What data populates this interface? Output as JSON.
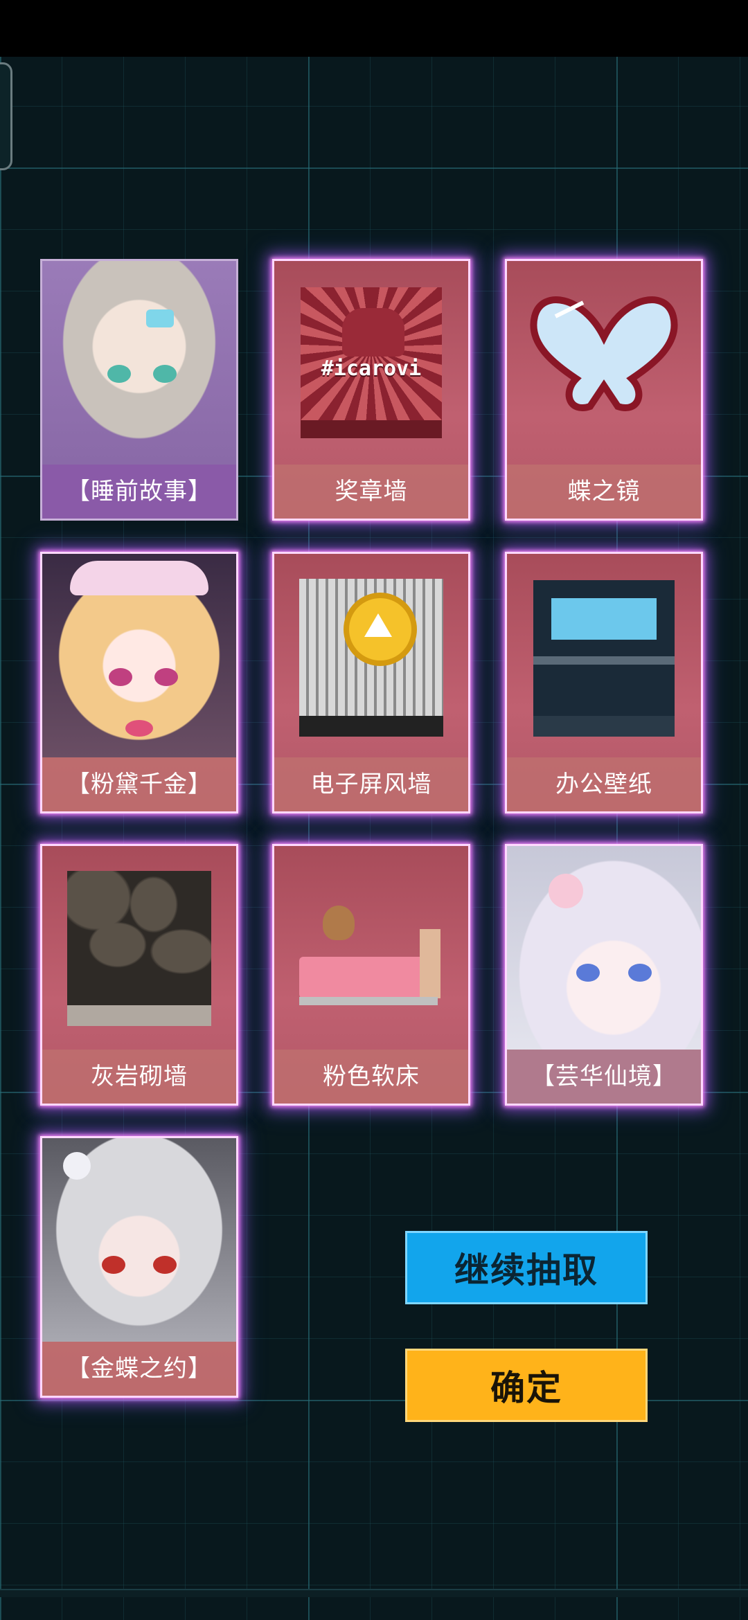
{
  "cards": [
    {
      "label": "【睡前故事】",
      "icon": "character-portrait"
    },
    {
      "label": "奖章墙",
      "icon": "medal-wall",
      "art_text": "#icarovi"
    },
    {
      "label": "蝶之镜",
      "icon": "butterfly-mirror"
    },
    {
      "label": "【粉黛千金】",
      "icon": "character-portrait"
    },
    {
      "label": "电子屏风墙",
      "icon": "screen-wall"
    },
    {
      "label": "办公壁纸",
      "icon": "office-wallpaper"
    },
    {
      "label": "灰岩砌墙",
      "icon": "stone-wall"
    },
    {
      "label": "粉色软床",
      "icon": "pink-bed"
    },
    {
      "label": "【芸华仙境】",
      "icon": "character-portrait"
    },
    {
      "label": "【金蝶之约】",
      "icon": "character-portrait"
    }
  ],
  "buttons": {
    "continue_label": "继续抽取",
    "confirm_label": "确定"
  },
  "colors": {
    "card_pink": "#b25868",
    "card_purple": "#8e6aa8",
    "continue_blue": "#12a5ec",
    "confirm_orange": "#ffb31a",
    "glow": "#c050ff"
  }
}
